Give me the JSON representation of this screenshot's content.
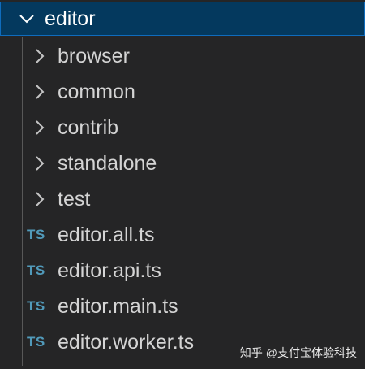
{
  "explorer": {
    "root_folder": {
      "label": "editor",
      "expanded": true,
      "icon": "chevron-down-icon"
    },
    "folders": [
      {
        "label": "browser",
        "icon": "chevron-right-icon"
      },
      {
        "label": "common",
        "icon": "chevron-right-icon"
      },
      {
        "label": "contrib",
        "icon": "chevron-right-icon"
      },
      {
        "label": "standalone",
        "icon": "chevron-right-icon"
      },
      {
        "label": "test",
        "icon": "chevron-right-icon"
      }
    ],
    "files": [
      {
        "label": "editor.all.ts",
        "badge": "TS"
      },
      {
        "label": "editor.api.ts",
        "badge": "TS"
      },
      {
        "label": "editor.main.ts",
        "badge": "TS"
      },
      {
        "label": "editor.worker.ts",
        "badge": "TS"
      }
    ]
  },
  "watermark": {
    "text": "知乎 @支付宝体验科技"
  },
  "colors": {
    "background": "#252526",
    "selected_row": "#04395e",
    "selected_border": "#0f6cbd",
    "text": "#d4d4d4",
    "ts_badge": "#519aba"
  }
}
